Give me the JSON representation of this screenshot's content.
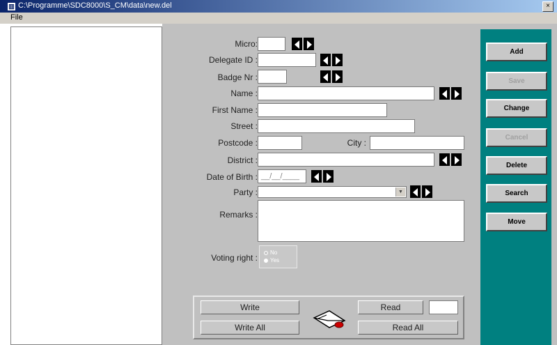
{
  "window": {
    "title": "C:\\Programme\\SDC8000\\S_CM\\data\\new.del",
    "close_glyph": "×"
  },
  "menu": {
    "file": "File"
  },
  "form": {
    "micro_label": "Micro:",
    "delegate_id_label": "Delegate ID :",
    "badge_nr_label": "Badge Nr :",
    "name_label": "Name :",
    "first_name_label": "First Name :",
    "street_label": "Street :",
    "postcode_label": "Postcode :",
    "city_label": "City :",
    "district_label": "District :",
    "dob_label": "Date of Birth :",
    "dob_value": "__/__/____",
    "party_label": "Party :",
    "remarks_label": "Remarks :",
    "voting_label": "Voting right :",
    "voting_options": [
      "No",
      "Yes"
    ],
    "voting_selected": "Yes"
  },
  "bottom": {
    "write": "Write",
    "write_all": "Write All",
    "read": "Read",
    "read_all": "Read All"
  },
  "actions": {
    "add": "Add",
    "save": "Save",
    "change": "Change",
    "cancel": "Cancel",
    "delete": "Delete",
    "search": "Search",
    "move": "Move"
  },
  "colors": {
    "accent": "#008080",
    "form_bg": "#c0c0c0",
    "title_start": "#0a246a"
  }
}
